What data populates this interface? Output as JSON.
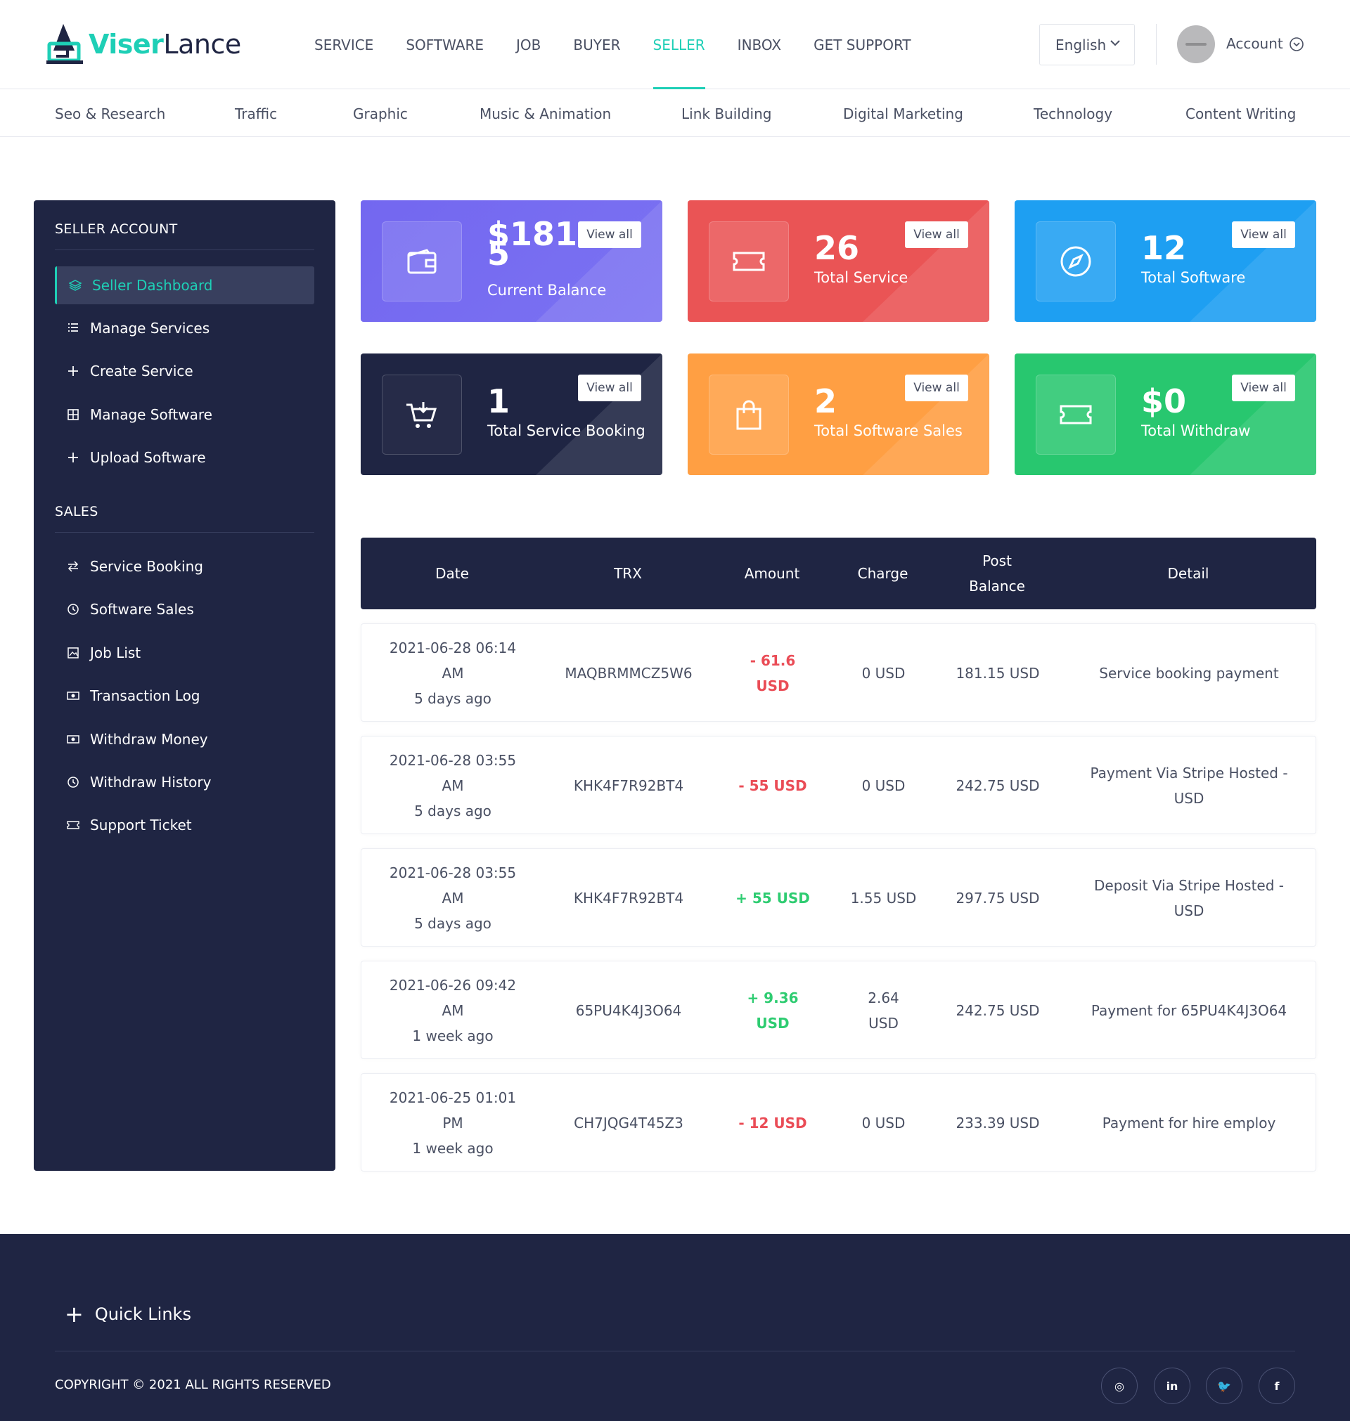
{
  "header": {
    "logo": {
      "part1": "Viser",
      "part2": "Lance"
    },
    "nav": [
      {
        "label": "SERVICE",
        "active": false
      },
      {
        "label": "SOFTWARE",
        "active": false
      },
      {
        "label": "JOB",
        "active": false
      },
      {
        "label": "BUYER",
        "active": false
      },
      {
        "label": "SELLER",
        "active": true
      },
      {
        "label": "INBOX",
        "active": false
      },
      {
        "label": "GET SUPPORT",
        "active": false
      }
    ],
    "language": "English",
    "account_label": "Account"
  },
  "categories": [
    "Seo & Research",
    "Traffic",
    "Graphic",
    "Music & Animation",
    "Link Building",
    "Digital Marketing",
    "Technology",
    "Content Writing"
  ],
  "sidebar": {
    "section1_title": "SELLER ACCOUNT",
    "section1_items": [
      {
        "label": "Seller Dashboard",
        "icon": "layers-icon",
        "active": true
      },
      {
        "label": "Manage Services",
        "icon": "list-icon"
      },
      {
        "label": "Create Service",
        "icon": "plus-icon"
      },
      {
        "label": "Manage Software",
        "icon": "grid-icon"
      },
      {
        "label": "Upload Software",
        "icon": "plus-icon"
      }
    ],
    "section2_title": "SALES",
    "section2_items": [
      {
        "label": "Service Booking",
        "icon": "exchange-icon"
      },
      {
        "label": "Software Sales",
        "icon": "history-icon"
      },
      {
        "label": "Job List",
        "icon": "image-icon"
      },
      {
        "label": "Transaction Log",
        "icon": "money-icon"
      },
      {
        "label": "Withdraw Money",
        "icon": "money-icon"
      },
      {
        "label": "Withdraw History",
        "icon": "history-icon"
      },
      {
        "label": "Support Ticket",
        "icon": "ticket-icon"
      }
    ]
  },
  "cards": [
    {
      "value_line1": "$181.1",
      "value_line2": "5",
      "label": "Current Balance",
      "button": "View all",
      "color": "#7367f0",
      "icon": "wallet-icon"
    },
    {
      "value": "26",
      "label": "Total Service",
      "button": "View all",
      "color": "#ea5455",
      "icon": "ticket-icon"
    },
    {
      "value": "12",
      "label": "Total Software",
      "button": "View all",
      "color": "#1e9ff2",
      "icon": "compass-icon"
    },
    {
      "value": "1",
      "label": "Total Service Booking",
      "button": "View all",
      "color": "#1f2543",
      "icon": "cart-icon"
    },
    {
      "value": "2",
      "label": "Total Software Sales",
      "button": "View all",
      "color": "#ff9f43",
      "icon": "bag-icon"
    },
    {
      "value": "$0",
      "label": "Total Withdraw",
      "button": "View all",
      "color": "#28c76f",
      "icon": "ticket-icon"
    }
  ],
  "table": {
    "headers": {
      "date": "Date",
      "trx": "TRX",
      "amount": "Amount",
      "charge": "Charge",
      "post_balance_1": "Post",
      "post_balance_2": "Balance",
      "detail": "Detail"
    },
    "rows": [
      {
        "date1": "2021-06-28 06:14",
        "date2": "AM",
        "ago": "5 days ago",
        "trx": "MAQBRMMCZ5W6",
        "amount1": "- 61.6",
        "amount2": "USD",
        "sign": "neg",
        "charge1": "0 USD",
        "charge2": "",
        "post": "181.15 USD",
        "detail1": "Service booking payment",
        "detail2": ""
      },
      {
        "date1": "2021-06-28 03:55",
        "date2": "AM",
        "ago": "5 days ago",
        "trx": "KHK4F7R92BT4",
        "amount1": "- 55 USD",
        "amount2": "",
        "sign": "neg",
        "charge1": "0 USD",
        "charge2": "",
        "post": "242.75 USD",
        "detail1": "Payment Via Stripe Hosted -",
        "detail2": "USD"
      },
      {
        "date1": "2021-06-28 03:55",
        "date2": "AM",
        "ago": "5 days ago",
        "trx": "KHK4F7R92BT4",
        "amount1": "+ 55 USD",
        "amount2": "",
        "sign": "pos",
        "charge1": "1.55 USD",
        "charge2": "",
        "post": "297.75 USD",
        "detail1": "Deposit Via Stripe Hosted -",
        "detail2": "USD"
      },
      {
        "date1": "2021-06-26 09:42",
        "date2": "AM",
        "ago": "1 week ago",
        "trx": "65PU4K4J3O64",
        "amount1": "+ 9.36",
        "amount2": "USD",
        "sign": "pos",
        "charge1": "2.64",
        "charge2": "USD",
        "post": "242.75 USD",
        "detail1": "Payment for 65PU4K4J3O64",
        "detail2": ""
      },
      {
        "date1": "2021-06-25 01:01",
        "date2": "PM",
        "ago": "1 week ago",
        "trx": "CH7JQG4T45Z3",
        "amount1": "- 12 USD",
        "amount2": "",
        "sign": "neg",
        "charge1": "0 USD",
        "charge2": "",
        "post": "233.39 USD",
        "detail1": "Payment for hire employ",
        "detail2": ""
      }
    ]
  },
  "footer": {
    "quick_links": "Quick Links",
    "copyright": "COPYRIGHT © 2021 ALL RIGHTS RESERVED",
    "social": [
      {
        "icon": "instagram-icon",
        "glyph": "◎"
      },
      {
        "icon": "linkedin-icon",
        "glyph": "in"
      },
      {
        "icon": "twitter-icon",
        "glyph": "🐦"
      },
      {
        "icon": "facebook-icon",
        "glyph": "f"
      }
    ]
  }
}
